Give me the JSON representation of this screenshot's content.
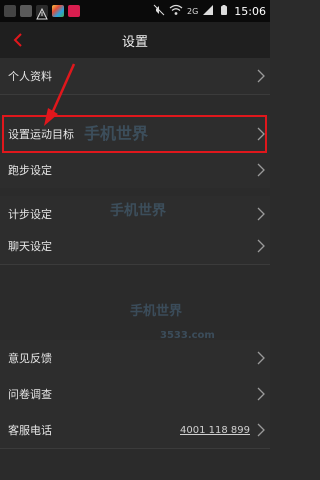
{
  "status_bar": {
    "signal_label": "2G",
    "time": "15:06"
  },
  "header": {
    "title": "设置"
  },
  "settings": {
    "items": [
      {
        "label": "个人资料"
      },
      {
        "label": "设置运动目标"
      },
      {
        "label": "跑步设定"
      },
      {
        "label": "计步设定"
      },
      {
        "label": "聊天设定"
      },
      {
        "label": "意见反馈"
      },
      {
        "label": "问卷调查"
      },
      {
        "label": "客服电话",
        "value": "4001 118 899"
      }
    ]
  },
  "watermark": {
    "brand": "手机世界",
    "domain": "3533.com"
  },
  "colors": {
    "accent": "#e0171c",
    "background": "#2b2b2b",
    "row_background": "#2d2d2d",
    "nav_background": "#1f1f1f"
  },
  "icons": {
    "back": "chevron-left-icon",
    "row_chevron": "chevron-right-icon"
  }
}
